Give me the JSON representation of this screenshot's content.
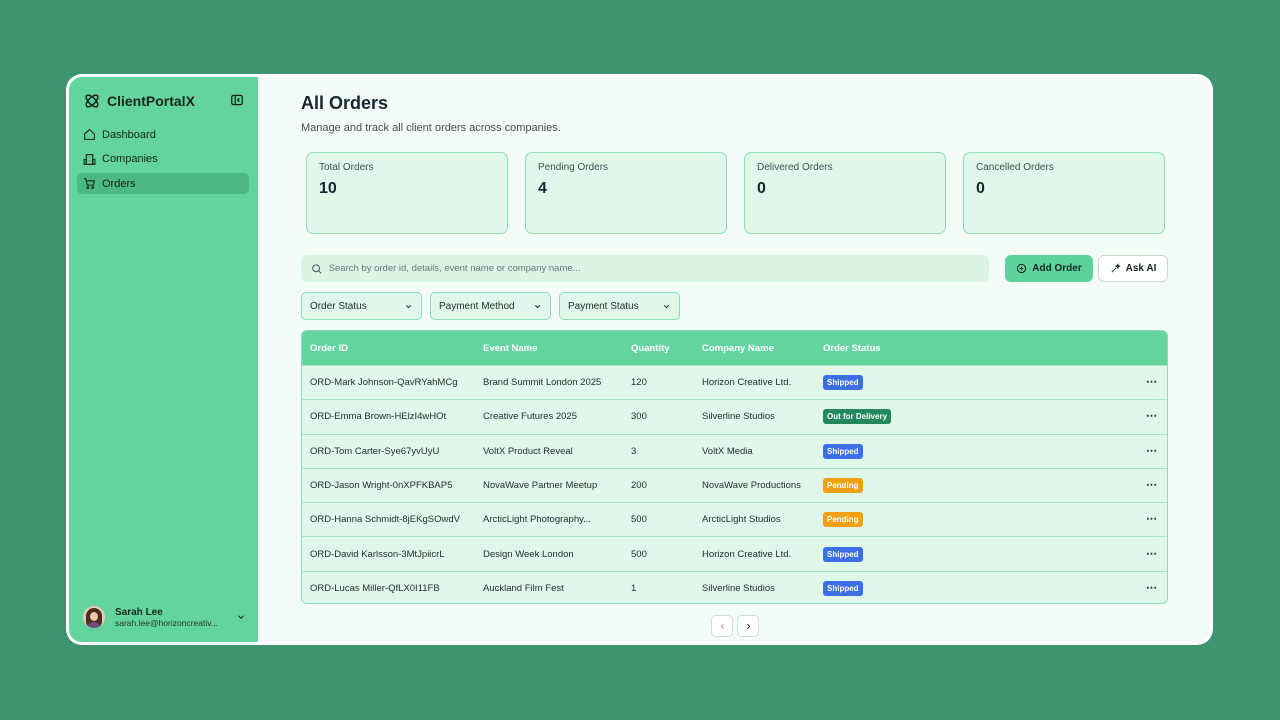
{
  "app": {
    "name": "ClientPortalX"
  },
  "sidebar": {
    "items": [
      {
        "label": "Dashboard",
        "icon": "home-icon"
      },
      {
        "label": "Companies",
        "icon": "building-icon"
      },
      {
        "label": "Orders",
        "icon": "cart-icon",
        "active": true
      }
    ]
  },
  "user": {
    "name": "Sarah Lee",
    "email": "sarah.lee@horizoncreativ..."
  },
  "page": {
    "title": "All Orders",
    "subtitle": "Manage and track all client orders across companies."
  },
  "stats": [
    {
      "label": "Total Orders",
      "value": "10"
    },
    {
      "label": "Pending Orders",
      "value": "4"
    },
    {
      "label": "Delivered Orders",
      "value": "0"
    },
    {
      "label": "Cancelled Orders",
      "value": "0"
    }
  ],
  "search": {
    "placeholder": "Search by order id, details, event name or company name..."
  },
  "actions": {
    "add_label": "Add Order",
    "ai_label": "Ask AI"
  },
  "filters": [
    {
      "label": "Order Status"
    },
    {
      "label": "Payment Method"
    },
    {
      "label": "Payment Status"
    }
  ],
  "table": {
    "columns": [
      "Order ID",
      "Event Name",
      "Quantity",
      "Company Name",
      "Order Status"
    ],
    "rows": [
      {
        "order_id": "ORD-Mark Johnson-QavRYahMCg",
        "event": "Brand Summit London 2025",
        "qty": "120",
        "company": "Horizon Creative Ltd.",
        "status": "Shipped",
        "status_color": "#3b6fe5"
      },
      {
        "order_id": "ORD-Emma Brown-HElzI4wHOt",
        "event": "Creative Futures 2025",
        "qty": "300",
        "company": "Silverline Studios",
        "status": "Out for Delivery",
        "status_color": "#24895a"
      },
      {
        "order_id": "ORD-Tom Carter-Sye67yvUyU",
        "event": "VoltX Product Reveal",
        "qty": "3",
        "company": "VoltX Media",
        "status": "Shipped",
        "status_color": "#3b6fe5"
      },
      {
        "order_id": "ORD-Jason Wright-0nXPFKBAP5",
        "event": "NovaWave Partner Meetup",
        "qty": "200",
        "company": "NovaWave Productions",
        "status": "Pending",
        "status_color": "#f0a013"
      },
      {
        "order_id": "ORD-Hanna Schmidt-8jEKgSOwdV",
        "event": "ArcticLight Photography...",
        "qty": "500",
        "company": "ArcticLight Studios",
        "status": "Pending",
        "status_color": "#f0a013"
      },
      {
        "order_id": "ORD-David Karlsson-3MtJpiicrL",
        "event": "Design Week London",
        "qty": "500",
        "company": "Horizon Creative Ltd.",
        "status": "Shipped",
        "status_color": "#3b6fe5"
      },
      {
        "order_id": "ORD-Lucas Miller-QfLX0I11FB",
        "event": "Auckland Film Fest",
        "qty": "1",
        "company": "Silverline Studios",
        "status": "Shipped",
        "status_color": "#3b6fe5"
      }
    ]
  },
  "colors": {
    "background": "#3f9470",
    "sidebar": "#64d49f",
    "accent": "#5ed29c"
  }
}
